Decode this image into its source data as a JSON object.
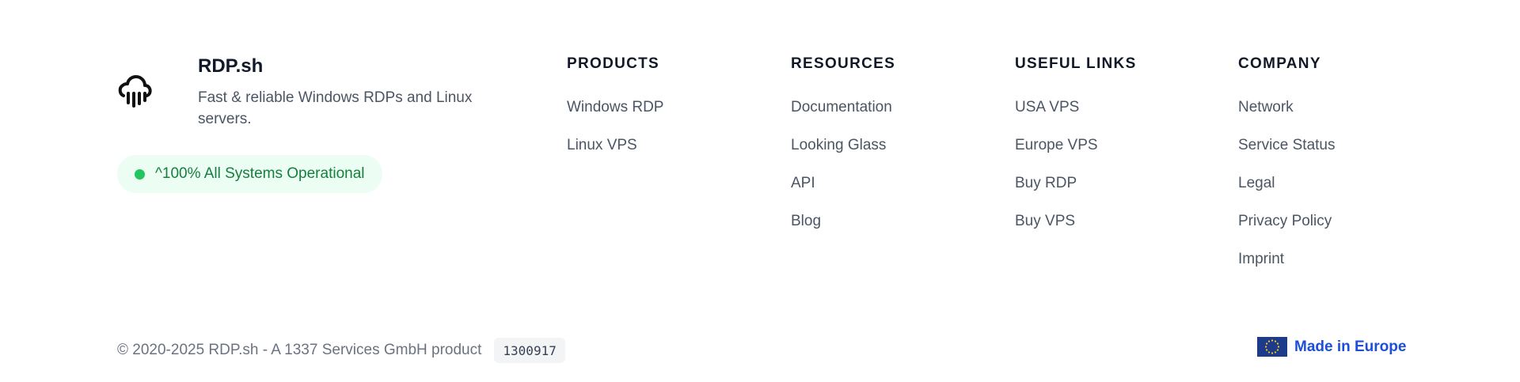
{
  "brand": {
    "name": "RDP.sh",
    "description": "Fast & reliable Windows RDPs and Linux servers.",
    "logo_icon": "cloud-rain-icon",
    "status": {
      "text": "^100% All Systems Operational",
      "dot_color": "#22c55e"
    }
  },
  "columns": [
    {
      "title": "PRODUCTS",
      "links": [
        "Windows RDP",
        "Linux VPS"
      ]
    },
    {
      "title": "RESOURCES",
      "links": [
        "Documentation",
        "Looking Glass",
        "API",
        "Blog"
      ]
    },
    {
      "title": "USEFUL LINKS",
      "links": [
        "USA VPS",
        "Europe VPS",
        "Buy RDP",
        "Buy VPS"
      ]
    },
    {
      "title": "COMPANY",
      "links": [
        "Network",
        "Service Status",
        "Legal",
        "Privacy Policy",
        "Imprint"
      ]
    }
  ],
  "bottom": {
    "copyright": "© 2020-2025 RDP.sh - A 1337 Services GmbH product",
    "build": "1300917",
    "made_in": "Made in Europe",
    "flag_icon": "eu-flag-icon"
  },
  "colors": {
    "accent_blue": "#1d4ed8",
    "status_green": "#15803d",
    "status_bg": "#ecfdf3"
  }
}
